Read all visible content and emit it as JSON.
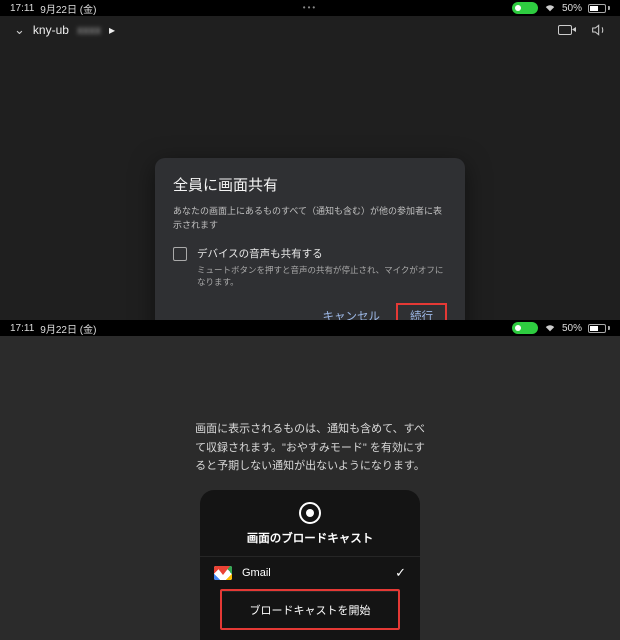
{
  "status": {
    "time": "17:11",
    "date": "9月22日 (金)",
    "battery_pct": "50%"
  },
  "meeting": {
    "code_prefix": "kny-ub",
    "continue_indicator": "▸"
  },
  "dialog": {
    "title": "全員に画面共有",
    "description": "あなたの画面上にあるものすべて（通知も含む）が他の参加者に表示されます",
    "checkbox_label": "デバイスの音声も共有する",
    "checkbox_note": "ミュートボタンを押すと音声の共有が停止され、マイクがオフになります。",
    "cancel": "キャンセル",
    "confirm": "続行"
  },
  "broadcast": {
    "info": "画面に表示されるものは、通知も含めて、すべて収録されます。\"おやすみモード\" を有効にすると予期しない通知が出ないようになります。",
    "sheet_title": "画面のブロードキャスト",
    "app": "Gmail",
    "start": "ブロードキャストを開始"
  }
}
